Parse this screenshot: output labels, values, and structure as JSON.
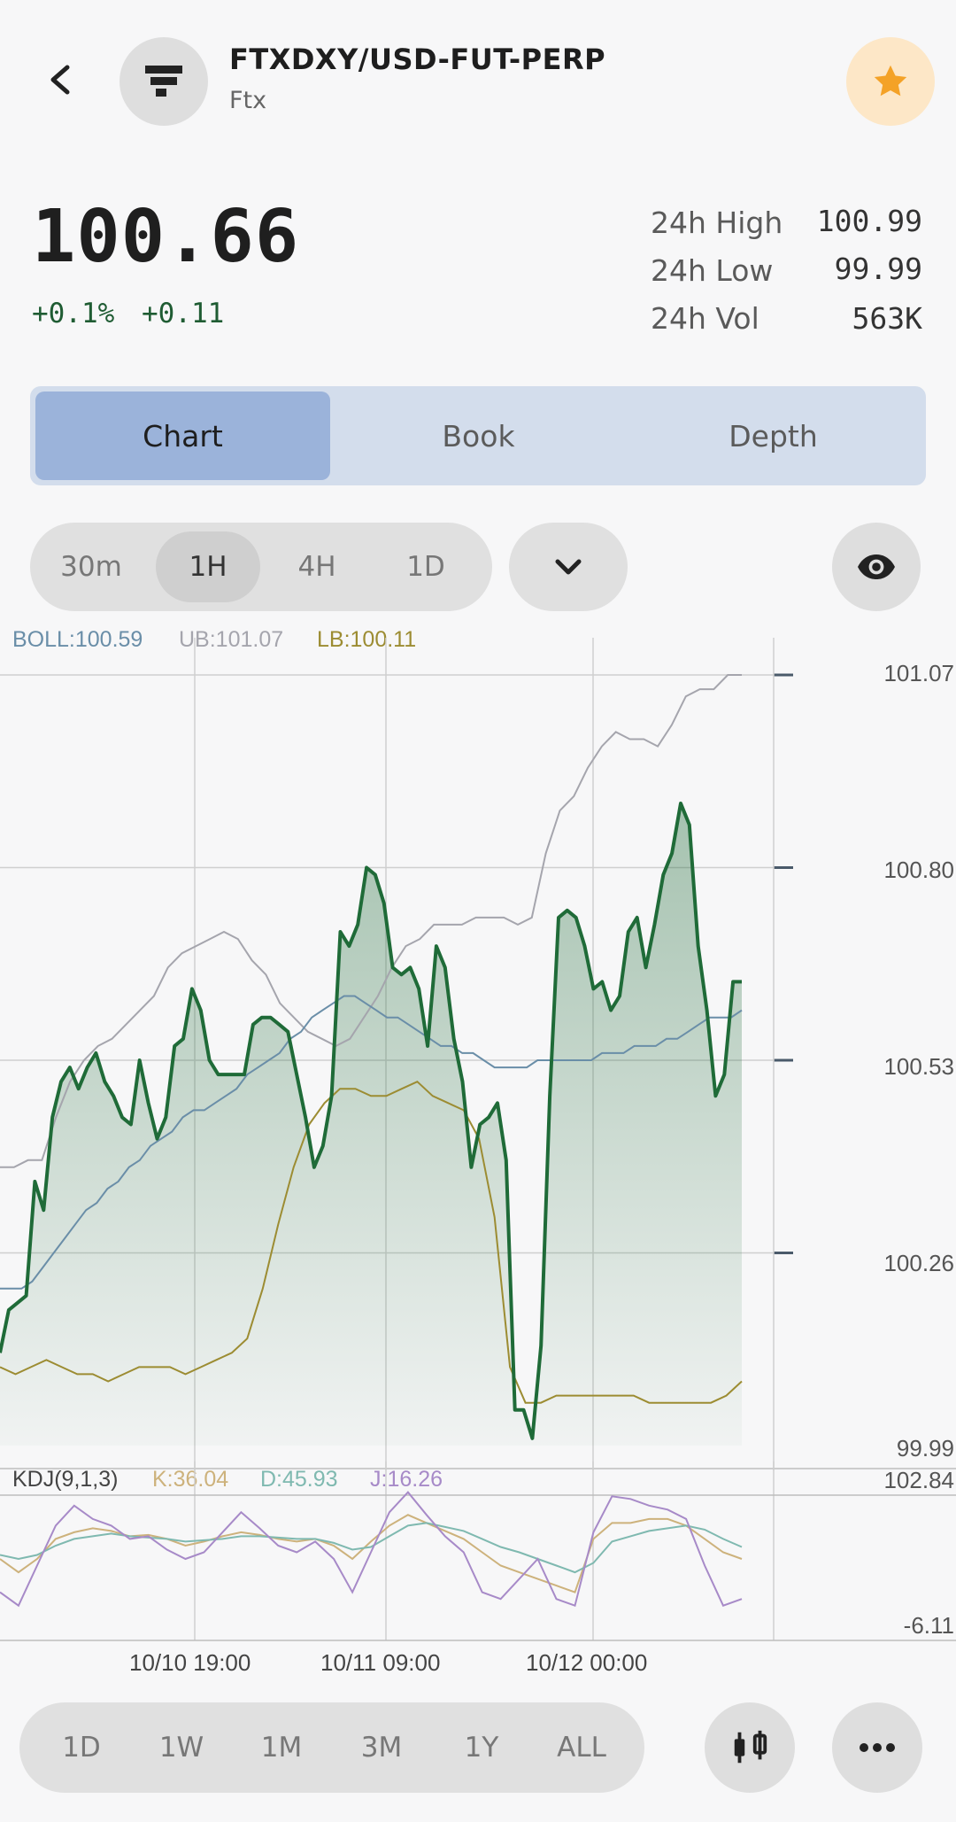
{
  "header": {
    "pair": "FTXDXY/USD-FUT-PERP",
    "exchange": "Ftx",
    "icons": {
      "back": "chevron-left-icon",
      "logo": "ftx-logo-icon",
      "favorite": "star-icon"
    }
  },
  "ticker": {
    "price": "100.66",
    "change_pct": "+0.1%",
    "change_abs": "+0.11",
    "high_label": "24h High",
    "high_value": "100.99",
    "low_label": "24h Low",
    "low_value": "99.99",
    "vol_label": "24h Vol",
    "vol_value": "563K"
  },
  "tabs": [
    "Chart",
    "Book",
    "Depth"
  ],
  "active_tab": "Chart",
  "intervals": [
    "30m",
    "1H",
    "4H",
    "1D"
  ],
  "active_interval": "1H",
  "ranges": [
    "1D",
    "1W",
    "1M",
    "3M",
    "1Y",
    "ALL"
  ],
  "colors": {
    "price_line": "#1f6b38",
    "boll_mid": "#6a8ea8",
    "boll_upper": "#a5a5ad",
    "boll_lower": "#9c8c32",
    "kdj_k": "#cdb27c",
    "kdj_d": "#7fb9b0",
    "kdj_j": "#a78ac8"
  },
  "chart_data": [
    {
      "type": "line",
      "legend": {
        "boll": "BOLL:100.59",
        "ub": "UB:101.07",
        "lb": "LB:100.11"
      },
      "y_ticks": [
        "101.07",
        "100.80",
        "100.53",
        "100.26",
        "99.99"
      ],
      "x_ticks": [
        "10/10 19:00",
        "10/11 09:00",
        "10/12 00:00"
      ],
      "ylim": [
        99.99,
        101.07
      ],
      "series": [
        {
          "name": "Price",
          "values": [
            100.12,
            100.18,
            100.19,
            100.2,
            100.36,
            100.32,
            100.45,
            100.5,
            100.52,
            100.49,
            100.52,
            100.54,
            100.5,
            100.48,
            100.45,
            100.44,
            100.53,
            100.47,
            100.42,
            100.45,
            100.55,
            100.56,
            100.63,
            100.6,
            100.53,
            100.51,
            100.51,
            100.51,
            100.51,
            100.58,
            100.59,
            100.59,
            100.58,
            100.57,
            100.51,
            100.45,
            100.38,
            100.41,
            100.48,
            100.71,
            100.69,
            100.72,
            100.8,
            100.79,
            100.75,
            100.66,
            100.65,
            100.66,
            100.63,
            100.55,
            100.69,
            100.66,
            100.56,
            100.5,
            100.38,
            100.44,
            100.45,
            100.47,
            100.39,
            100.04,
            100.04,
            100.0,
            100.13,
            100.48,
            100.73,
            100.74,
            100.73,
            100.69,
            100.63,
            100.64,
            100.6,
            100.62,
            100.71,
            100.73,
            100.66,
            100.72,
            100.79,
            100.82,
            100.89,
            100.86,
            100.69,
            100.6,
            100.48,
            100.51,
            100.64,
            100.64
          ]
        },
        {
          "name": "BOLL",
          "values": [
            100.21,
            100.21,
            100.21,
            100.22,
            100.24,
            100.26,
            100.28,
            100.3,
            100.32,
            100.33,
            100.35,
            100.36,
            100.38,
            100.39,
            100.41,
            100.42,
            100.43,
            100.45,
            100.46,
            100.46,
            100.47,
            100.48,
            100.49,
            100.51,
            100.52,
            100.53,
            100.54,
            100.56,
            100.57,
            100.59,
            100.6,
            100.61,
            100.62,
            100.62,
            100.61,
            100.6,
            100.59,
            100.59,
            100.58,
            100.57,
            100.56,
            100.55,
            100.55,
            100.54,
            100.54,
            100.53,
            100.52,
            100.52,
            100.52,
            100.52,
            100.53,
            100.53,
            100.53,
            100.53,
            100.53,
            100.53,
            100.54,
            100.54,
            100.54,
            100.55,
            100.55,
            100.55,
            100.56,
            100.56,
            100.57,
            100.58,
            100.59,
            100.59,
            100.59,
            100.6
          ]
        },
        {
          "name": "UB",
          "values": [
            100.38,
            100.38,
            100.39,
            100.39,
            100.45,
            100.5,
            100.53,
            100.55,
            100.56,
            100.58,
            100.6,
            100.62,
            100.66,
            100.68,
            100.69,
            100.7,
            100.71,
            100.7,
            100.67,
            100.65,
            100.61,
            100.59,
            100.57,
            100.56,
            100.55,
            100.56,
            100.59,
            100.62,
            100.66,
            100.69,
            100.7,
            100.72,
            100.72,
            100.72,
            100.73,
            100.73,
            100.73,
            100.72,
            100.73,
            100.82,
            100.88,
            100.9,
            100.94,
            100.97,
            100.99,
            100.98,
            100.98,
            100.97,
            101.0,
            101.04,
            101.05,
            101.05,
            101.07,
            101.07
          ]
        },
        {
          "name": "LB",
          "values": [
            100.1,
            100.09,
            100.1,
            100.11,
            100.1,
            100.09,
            100.09,
            100.08,
            100.09,
            100.1,
            100.1,
            100.1,
            100.09,
            100.1,
            100.11,
            100.12,
            100.14,
            100.21,
            100.3,
            100.38,
            100.44,
            100.47,
            100.49,
            100.49,
            100.48,
            100.48,
            100.49,
            100.5,
            100.48,
            100.47,
            100.46,
            100.42,
            100.31,
            100.1,
            100.05,
            100.05,
            100.06,
            100.06,
            100.06,
            100.06,
            100.06,
            100.06,
            100.05,
            100.05,
            100.05,
            100.05,
            100.05,
            100.06,
            100.08
          ]
        }
      ]
    },
    {
      "type": "line",
      "legend": {
        "title": "KDJ(9,1,3)",
        "k": "K:36.04",
        "d": "D:45.93",
        "j": "J:16.26"
      },
      "y_ticks": [
        "102.84",
        "-6.11"
      ],
      "ylim": [
        -6.11,
        102.84
      ],
      "series": [
        {
          "name": "K",
          "values": [
            55,
            45,
            55,
            70,
            75,
            78,
            76,
            72,
            73,
            70,
            65,
            68,
            72,
            75,
            73,
            70,
            68,
            70,
            65,
            55,
            68,
            80,
            88,
            82,
            76,
            70,
            60,
            50,
            45,
            40,
            35,
            30,
            70,
            82,
            82,
            85,
            85,
            80,
            70,
            60,
            55
          ]
        },
        {
          "name": "D",
          "values": [
            58,
            55,
            58,
            65,
            70,
            72,
            74,
            72,
            71,
            70,
            68,
            69,
            70,
            72,
            72,
            71,
            70,
            70,
            67,
            62,
            64,
            72,
            80,
            82,
            79,
            76,
            70,
            64,
            60,
            55,
            50,
            45,
            52,
            68,
            72,
            76,
            78,
            80,
            77,
            70,
            64
          ]
        },
        {
          "name": "J",
          "values": [
            30,
            20,
            50,
            80,
            95,
            85,
            80,
            70,
            72,
            62,
            55,
            60,
            75,
            90,
            78,
            65,
            60,
            68,
            55,
            30,
            60,
            90,
            105,
            88,
            72,
            60,
            30,
            25,
            40,
            55,
            25,
            20,
            75,
            102,
            100,
            95,
            92,
            85,
            50,
            20,
            25
          ]
        }
      ]
    }
  ],
  "toolbar": {
    "candle": "candlestick-icon",
    "more": "more-horizontal-icon",
    "eye": "eye-icon",
    "dropdown": "chevron-down-icon"
  }
}
